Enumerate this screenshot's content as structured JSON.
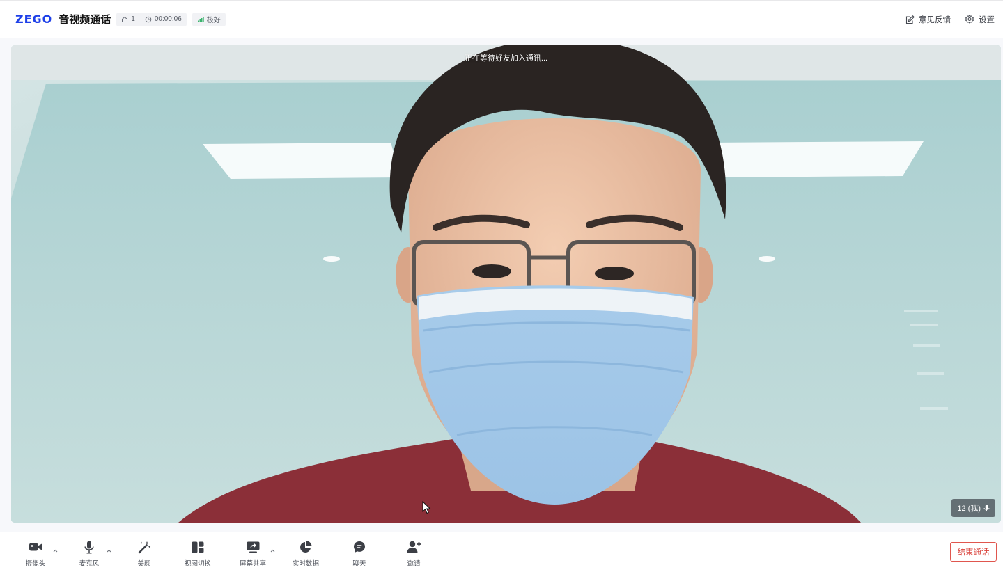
{
  "header": {
    "logo_text": "ZEGO",
    "app_title": "音视频通话",
    "room_count": "1",
    "duration": "00:00:06",
    "network_quality": "极好",
    "feedback_label": "意见反馈",
    "settings_label": "设置"
  },
  "video": {
    "status_text": "正在等待好友加入通讯...",
    "user_tag": "12 (我)"
  },
  "toolbar": {
    "camera_label": "摄像头",
    "microphone_label": "麦克风",
    "beauty_label": "美颜",
    "view_switch_label": "视图切换",
    "screen_share_label": "屏幕共享",
    "realtime_data_label": "实时数据",
    "chat_label": "聊天",
    "invite_label": "邀请",
    "end_call_label": "结束通话"
  },
  "colors": {
    "brand": "#1e40e8",
    "end_call": "#d9413a",
    "icon": "#3c3f46"
  },
  "icons": {
    "room": "home-icon",
    "timer": "clock-icon",
    "network": "signal-bars-icon",
    "feedback": "edit-note-icon",
    "settings": "gear-icon",
    "camera": "video-camera-icon",
    "microphone": "microphone-icon",
    "beauty": "magic-wand-icon",
    "view_switch": "layout-grid-icon",
    "screen_share": "screen-share-icon",
    "realtime_data": "pie-chart-icon",
    "chat": "chat-bubble-icon",
    "invite": "add-user-icon"
  }
}
